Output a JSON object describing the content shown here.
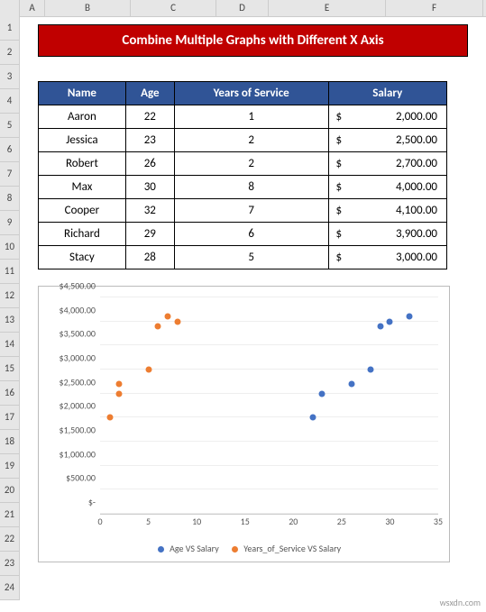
{
  "col_headers": [
    "",
    "A",
    "B",
    "C",
    "D",
    "E",
    "F"
  ],
  "row_headers": [
    "1",
    "2",
    "3",
    "4",
    "5",
    "6",
    "7",
    "8",
    "9",
    "10",
    "11",
    "12",
    "13",
    "14",
    "15",
    "16",
    "17",
    "18",
    "19",
    "20",
    "21",
    "22",
    "23",
    "24"
  ],
  "title": "Combine Multiple Graphs with Different X Axis",
  "table": {
    "headers": {
      "name": "Name",
      "age": "Age",
      "years": "Years of Service",
      "salary": "Salary"
    },
    "rows": [
      {
        "name": "Aaron",
        "age": "22",
        "years": "1",
        "salary": "2,000.00"
      },
      {
        "name": "Jessica",
        "age": "23",
        "years": "2",
        "salary": "2,500.00"
      },
      {
        "name": "Robert",
        "age": "26",
        "years": "2",
        "salary": "2,700.00"
      },
      {
        "name": "Max",
        "age": "30",
        "years": "8",
        "salary": "4,000.00"
      },
      {
        "name": "Cooper",
        "age": "32",
        "years": "7",
        "salary": "4,100.00"
      },
      {
        "name": "Richard",
        "age": "29",
        "years": "6",
        "salary": "3,900.00"
      },
      {
        "name": "Stacy",
        "age": "28",
        "years": "5",
        "salary": "3,000.00"
      }
    ]
  },
  "chart_data": {
    "type": "scatter",
    "xlabel": "",
    "ylabel": "",
    "xlim": [
      0,
      35
    ],
    "ylim": [
      0,
      4500
    ],
    "y_ticks": [
      {
        "v": 0,
        "label": "$-"
      },
      {
        "v": 500,
        "label": "$500.00"
      },
      {
        "v": 1000,
        "label": "$1,000.00"
      },
      {
        "v": 1500,
        "label": "$1,500.00"
      },
      {
        "v": 2000,
        "label": "$2,000.00"
      },
      {
        "v": 2500,
        "label": "$2,500.00"
      },
      {
        "v": 3000,
        "label": "$3,000.00"
      },
      {
        "v": 3500,
        "label": "$3,500.00"
      },
      {
        "v": 4000,
        "label": "$4,000.00"
      },
      {
        "v": 4500,
        "label": "$4,500.00"
      }
    ],
    "x_ticks": [
      0,
      5,
      10,
      15,
      20,
      25,
      30,
      35
    ],
    "series": [
      {
        "name": "Age VS Salary",
        "color": "#4472c4",
        "points": [
          {
            "x": 22,
            "y": 2000
          },
          {
            "x": 23,
            "y": 2500
          },
          {
            "x": 26,
            "y": 2700
          },
          {
            "x": 30,
            "y": 4000
          },
          {
            "x": 32,
            "y": 4100
          },
          {
            "x": 29,
            "y": 3900
          },
          {
            "x": 28,
            "y": 3000
          }
        ]
      },
      {
        "name": "Years_of_Service VS Salary",
        "color": "#ed7d31",
        "points": [
          {
            "x": 1,
            "y": 2000
          },
          {
            "x": 2,
            "y": 2500
          },
          {
            "x": 2,
            "y": 2700
          },
          {
            "x": 8,
            "y": 4000
          },
          {
            "x": 7,
            "y": 4100
          },
          {
            "x": 6,
            "y": 3900
          },
          {
            "x": 5,
            "y": 3000
          }
        ]
      }
    ]
  },
  "watermark": "wsxdn.com"
}
